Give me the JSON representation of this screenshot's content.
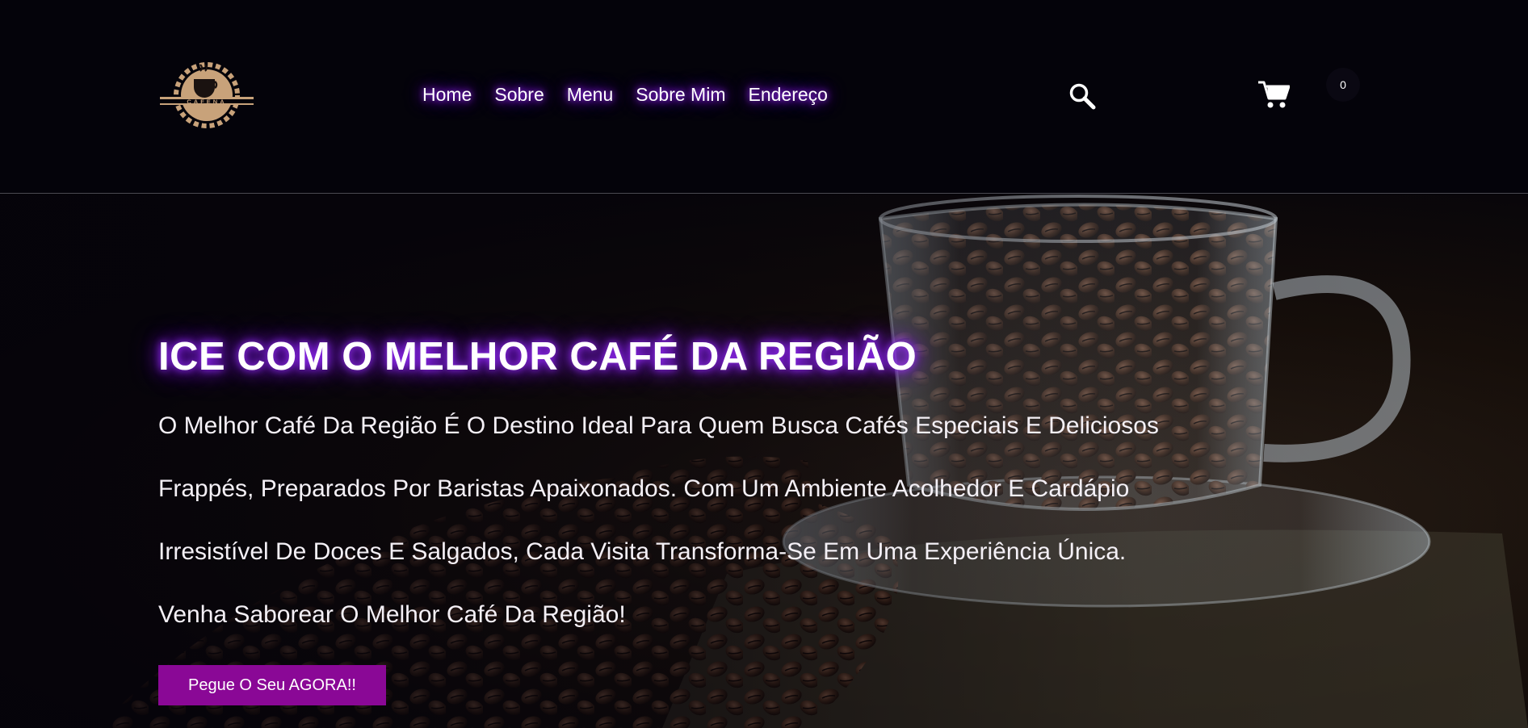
{
  "brand": {
    "name": "CAFENA"
  },
  "nav": {
    "items": [
      {
        "label": "Home"
      },
      {
        "label": "Sobre"
      },
      {
        "label": "Menu"
      },
      {
        "label": "Sobre Mim"
      },
      {
        "label": "Endereço"
      }
    ]
  },
  "header": {
    "search_icon": "search-icon",
    "cart_icon": "cart-icon",
    "cart_count": "0"
  },
  "hero": {
    "title": "ICE COM O MELHOR CAFÉ DA REGIÃO",
    "lines": [
      "O Melhor Café Da Região É O Destino Ideal Para Quem Busca Cafés Especiais E Deliciosos",
      "Frappés, Preparados Por Baristas Apaixonados. Com Um Ambiente Acolhedor E Cardápio",
      "Irresistível De Doces E Salgados, Cada Visita Transforma-Se Em Uma Experiência Única.",
      "Venha Saborear O Melhor Café Da Região!"
    ],
    "cta_label": "Pegue O Seu AGORA!!"
  },
  "colors": {
    "accent": "#8a0896",
    "glow": "#9b30ff",
    "header_bg": "#04030a",
    "logo_gold": "#c8a27a"
  }
}
